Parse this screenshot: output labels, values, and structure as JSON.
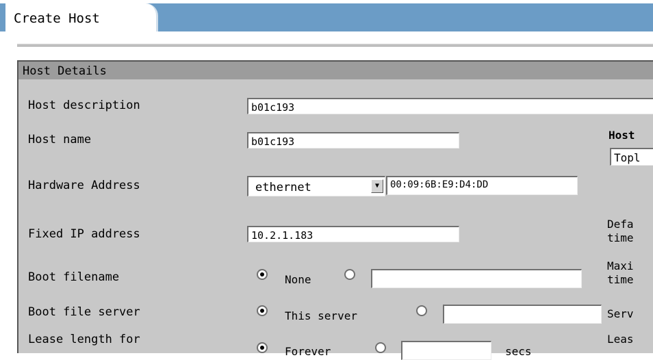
{
  "tab": {
    "title": "Create Host"
  },
  "panel": {
    "title": "Host Details",
    "fields": {
      "description": {
        "label": "Host description",
        "value": "b01c193"
      },
      "name": {
        "label": "Host name",
        "value": "b01c193"
      },
      "hardware": {
        "label": "Hardware Address",
        "type_value": "ethernet",
        "address": "00:09:6B:E9:D4:DD"
      },
      "fixed_ip": {
        "label": "Fixed IP address",
        "value": "10.2.1.183"
      },
      "boot_filename": {
        "label": "Boot filename",
        "option1": "None",
        "custom_value": ""
      },
      "boot_server": {
        "label": "Boot file server",
        "option1": "This server",
        "custom_value": ""
      },
      "lease": {
        "label": "Lease length for",
        "option1": "Forever",
        "custom_value": "",
        "unit": "secs"
      }
    },
    "right_column": {
      "host_label": "Host",
      "host_select_value": "Topl",
      "default_label_line1": "Defa",
      "default_label_line2": "time",
      "max_label_line1": "Maxi",
      "max_label_line2": "time",
      "server_label": "Serv",
      "lease_label": "Leas"
    }
  }
}
